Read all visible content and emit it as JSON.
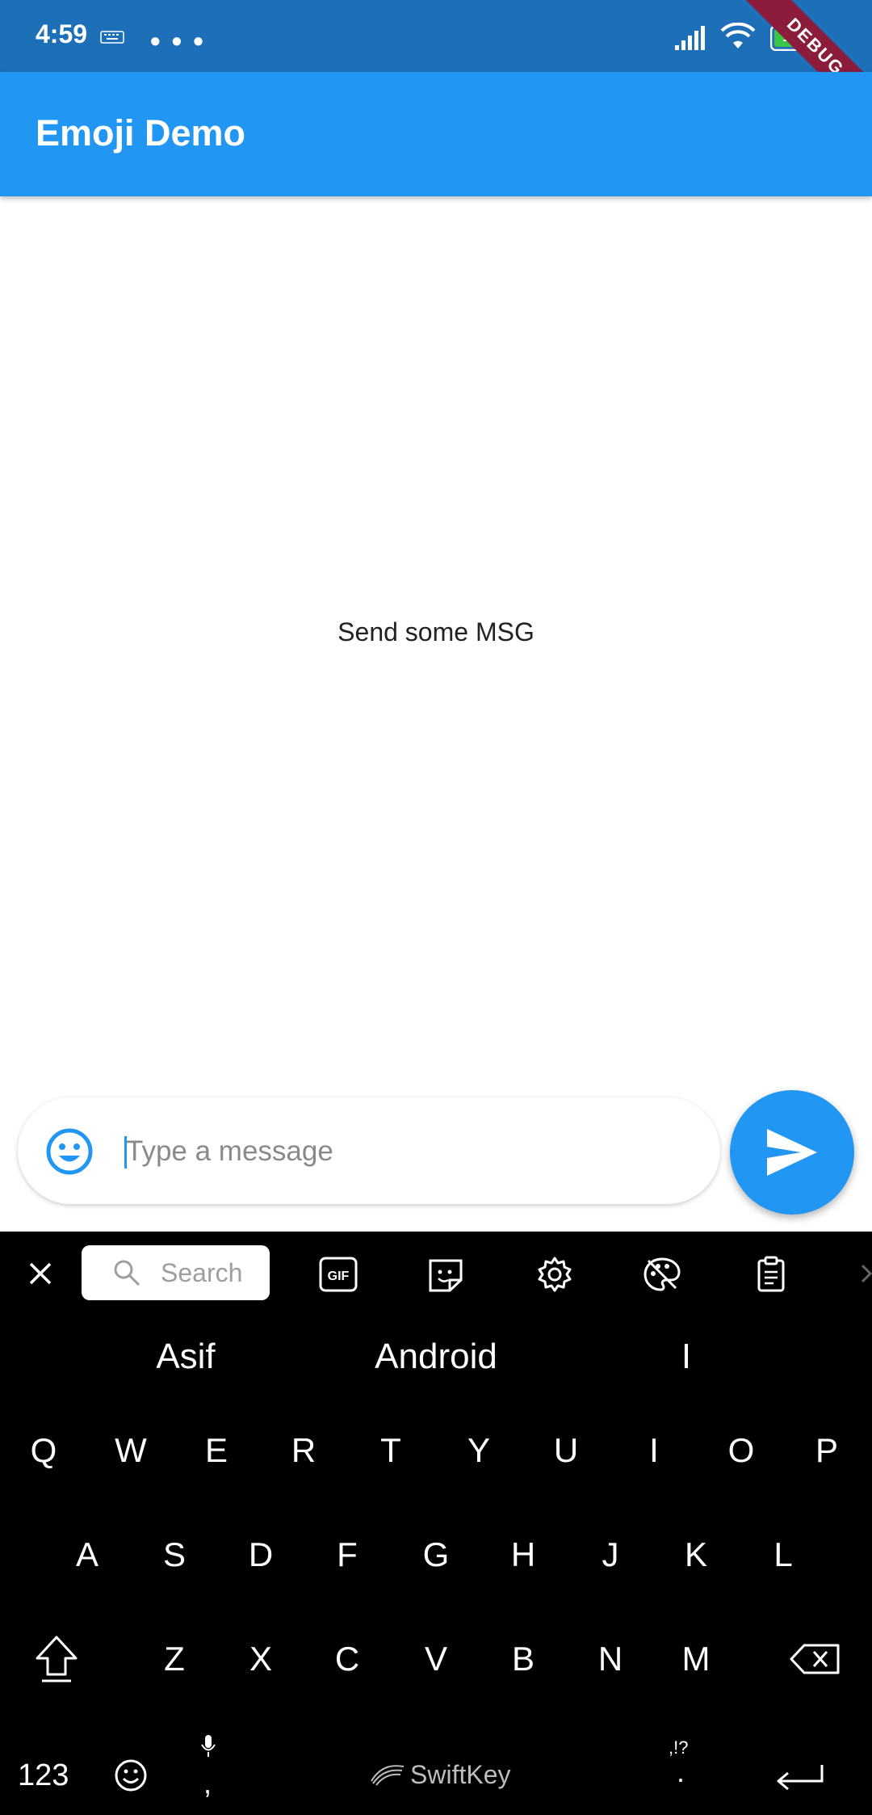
{
  "status_bar": {
    "time": "4:59",
    "overflow": "• • •",
    "battery": "100",
    "debug_label": "DEBUG"
  },
  "app_bar": {
    "title": "Emoji Demo"
  },
  "content": {
    "message": "Send some MSG"
  },
  "input": {
    "placeholder": "Type a message"
  },
  "keyboard": {
    "search_placeholder": "Search",
    "gif_label": "GIF",
    "suggestions": [
      "Asif",
      "Android",
      "I"
    ],
    "row1": [
      "Q",
      "W",
      "E",
      "R",
      "T",
      "Y",
      "U",
      "I",
      "O",
      "P"
    ],
    "row2": [
      "A",
      "S",
      "D",
      "F",
      "G",
      "H",
      "J",
      "K",
      "L"
    ],
    "row3": [
      "Z",
      "X",
      "C",
      "V",
      "B",
      "N",
      "M"
    ],
    "num_label": "123",
    "comma": ",",
    "brand": "SwiftKey",
    "punct_hint": ",!?",
    "period": "."
  },
  "colors": {
    "status_bar": "#1d6fb8",
    "app_bar": "#2196f3",
    "accent": "#2196f3",
    "keyboard_bg": "#000000",
    "debug_ribbon": "#8b1c3b"
  }
}
